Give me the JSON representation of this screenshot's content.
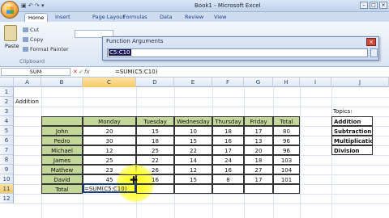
{
  "window": {
    "title": "Book1 - Microsoft Excel"
  },
  "tabs": [
    "Home",
    "Insert",
    "Page Layout",
    "Formulas",
    "Data",
    "Review",
    "View"
  ],
  "ribbon": {
    "paste": "Paste",
    "cut": "Cut",
    "copy": "Copy",
    "format_painter": "Format Painter",
    "group_label": "Clipboard"
  },
  "dialog": {
    "title": "Function Arguments",
    "input_value": "C5:C10"
  },
  "formula_bar": {
    "name_box": "SUM",
    "fx": "fx",
    "formula": "=SUM(C5:C10)"
  },
  "columns": [
    "A",
    "B",
    "C",
    "D",
    "E",
    "F",
    "G",
    "H",
    "I",
    "J"
  ],
  "rows": [
    "1",
    "2",
    "3",
    "4",
    "5",
    "6",
    "7",
    "8",
    "9",
    "10",
    "11",
    "12"
  ],
  "sheet": {
    "title": "Addition",
    "headers": [
      "Monday",
      "Tuesday",
      "Wednesday",
      "Thursday",
      "Friday",
      "Total"
    ],
    "data": [
      {
        "name": "John",
        "values": [
          "20",
          "15",
          "10",
          "18",
          "17",
          "80"
        ]
      },
      {
        "name": "Pedro",
        "values": [
          "30",
          "18",
          "15",
          "16",
          "13",
          "96"
        ]
      },
      {
        "name": "Michael",
        "values": [
          "12",
          "25",
          "22",
          "17",
          "20",
          "96"
        ]
      },
      {
        "name": "James",
        "values": [
          "25",
          "22",
          "14",
          "24",
          "18",
          "103"
        ]
      },
      {
        "name": "Mathew",
        "values": [
          "23",
          "26",
          "12",
          "16",
          "27",
          "104"
        ]
      },
      {
        "name": "David",
        "values": [
          "45",
          "16",
          "15",
          "8",
          "17",
          "101"
        ]
      }
    ],
    "total_label": "Total",
    "editing_formula": "=SUM(C5:C10)",
    "topics_label": "Topics:",
    "topics": [
      "Addition",
      "Subtraction",
      "Multiplication",
      "Division"
    ]
  }
}
